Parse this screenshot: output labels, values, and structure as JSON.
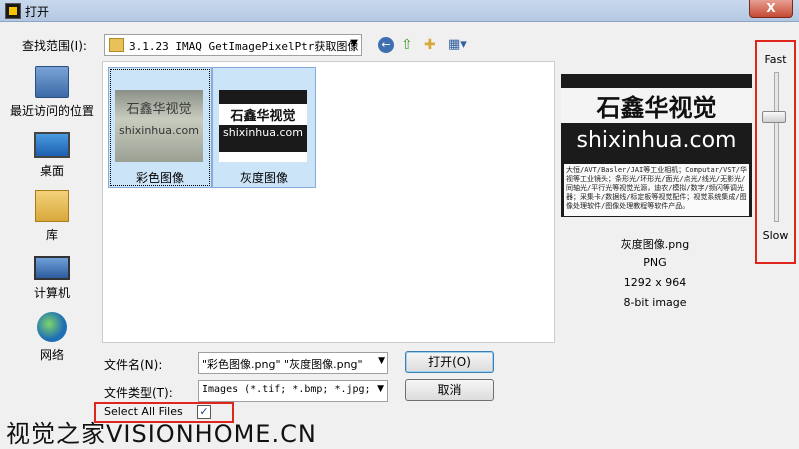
{
  "window": {
    "title": "打开",
    "close_label": "X"
  },
  "lookin": {
    "label": "查找范围(I):",
    "path": "3.1.23 IMAQ GetImagePixelPtr获取图像",
    "dropdown_glyph": "▼"
  },
  "toolbar": {
    "back_glyph": "←",
    "up_glyph": "⇧",
    "newfolder_glyph": "✚",
    "view_glyph": "▦▾"
  },
  "places": [
    {
      "label": "最近访问的位置",
      "icon": "recent-places-icon"
    },
    {
      "label": "桌面",
      "icon": "desktop-icon"
    },
    {
      "label": "库",
      "icon": "library-icon"
    },
    {
      "label": "计算机",
      "icon": "computer-icon"
    },
    {
      "label": "网络",
      "icon": "network-icon"
    }
  ],
  "files": [
    {
      "name": "彩色图像",
      "thumb_title": "石鑫华视觉",
      "thumb_url": "shixinhua.com"
    },
    {
      "name": "灰度图像",
      "thumb_title": "石鑫华视觉",
      "thumb_url": "shixinhua.com"
    }
  ],
  "preview": {
    "title": "石鑫华视觉",
    "url": "shixinhua.com",
    "desc": "大恒/AVT/Basler/JAI等工业相机；Computar/VST/华视等工业镜头；条形光/环形光/面光/点光/线光/无影光/同轴光/平行光等视觉光源，迪农/模拟/数字/频闪等调光器；采集卡/数据线/标定板等视觉配件；视觉系统集成/图像处理软件/图像处理教程等软件产品。",
    "filename": "灰度图像.png",
    "format": "PNG",
    "dimensions": "1292 x 964",
    "bitdepth": "8-bit image"
  },
  "slider": {
    "fast_label": "Fast",
    "slow_label": "Slow",
    "level": 0.3
  },
  "form": {
    "filename_label": "文件名(N):",
    "filename_value": "\"彩色图像.png\" \"灰度图像.png\"",
    "filetype_label": "文件类型(T):",
    "filetype_value": "Images (*.tif; *.bmp; *.jpg; *.png)",
    "dropdown_glyph": "▼"
  },
  "buttons": {
    "open": "打开(O)",
    "cancel": "取消"
  },
  "select_all": {
    "label": "Select All Files",
    "checked": "✓"
  },
  "watermark": "视觉之家VISIONHOME.CN",
  "colors": {
    "highlight_box": "#e0261c",
    "selection": "#cce4f7"
  }
}
